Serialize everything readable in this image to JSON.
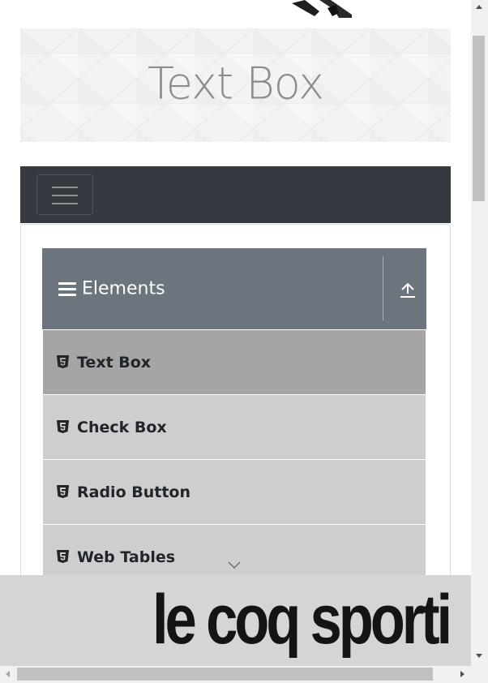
{
  "banner": {
    "title": "Text Box"
  },
  "group": {
    "title": "Elements"
  },
  "menu": {
    "items": [
      {
        "label": "Text Box"
      },
      {
        "label": "Check Box"
      },
      {
        "label": "Radio Button"
      },
      {
        "label": "Web Tables"
      }
    ]
  },
  "ad": {
    "text": "le coq sporti"
  },
  "colors": {
    "navbar": "#343a40",
    "group_header": "#6c757d",
    "menu_item": "#cecece",
    "menu_item_active": "#a5a5a5"
  },
  "icons": {
    "toggler": "hamburger-icon",
    "group": "menu-icon",
    "collapse": "upload-arrow-icon",
    "item": "html5-icon",
    "more": "chevron-down-icon"
  }
}
